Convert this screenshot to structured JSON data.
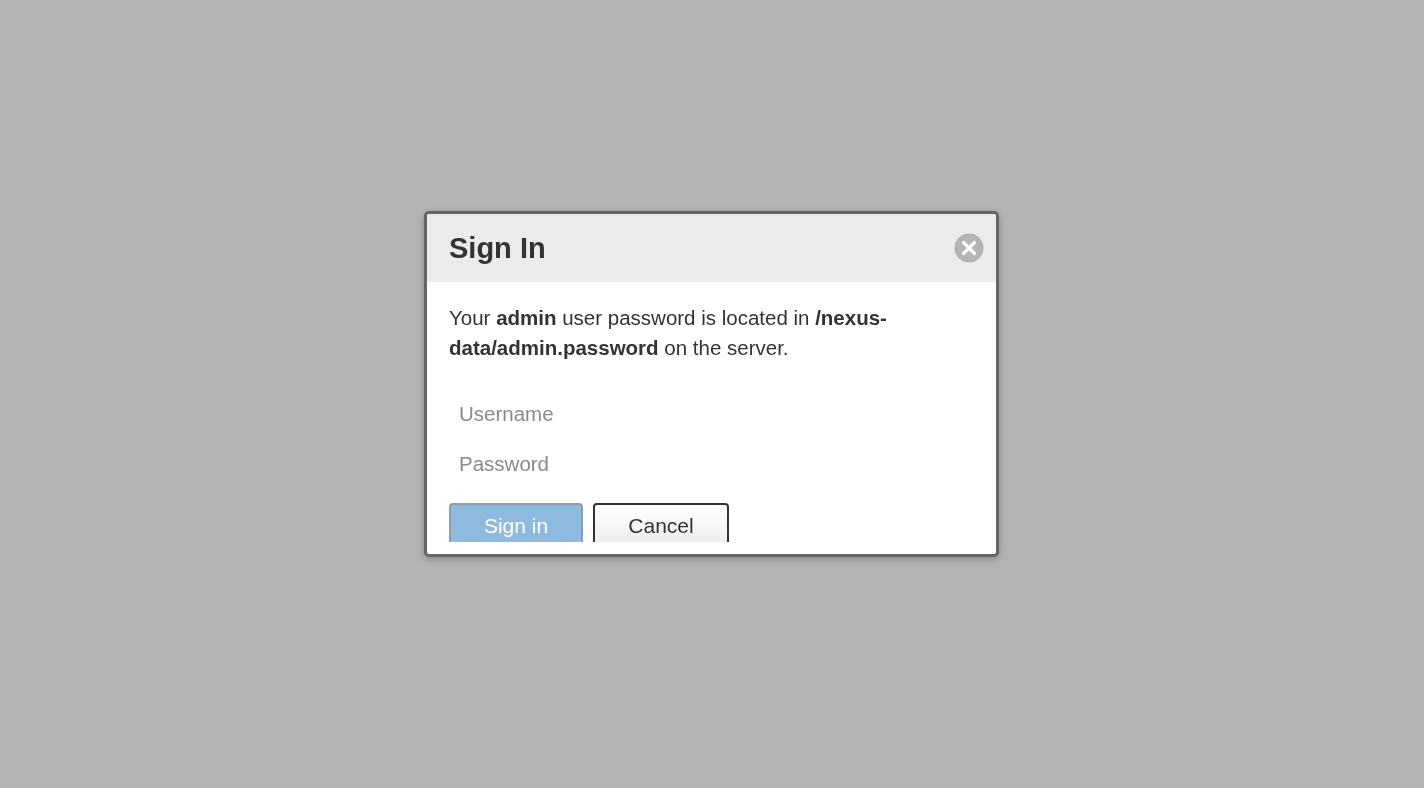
{
  "dialog": {
    "title": "Sign In",
    "message": "Your **admin** user password is located in **/nexus-data/admin.password** on the server.",
    "fields": [
      {
        "placeholder": "Username"
      },
      {
        "placeholder": "Password"
      }
    ],
    "buttons": [
      {
        "label": "Sign in",
        "kind": "primary",
        "disabled": true
      },
      {
        "label": "Cancel",
        "kind": "secondary",
        "disabled": false
      }
    ]
  }
}
